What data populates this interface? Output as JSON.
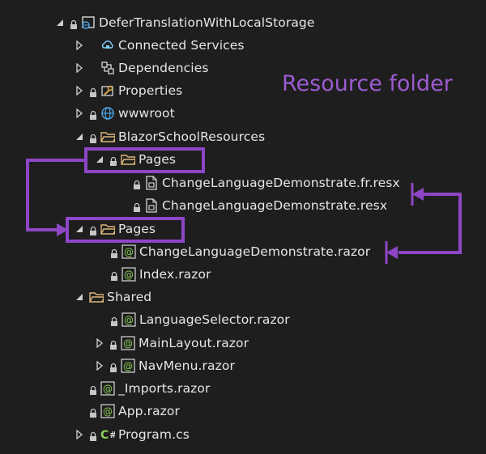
{
  "annotation": "Resource folder",
  "accent_color": "#8e46c7",
  "tree": [
    {
      "label": "DeferTranslationWithLocalStorage",
      "icon": "project-icon",
      "arrow": "expanded",
      "lock": true
    },
    {
      "label": "Connected Services",
      "icon": "cloud-service-icon",
      "arrow": "collapsed",
      "lock": false
    },
    {
      "label": "Dependencies",
      "icon": "dependencies-icon",
      "arrow": "collapsed",
      "lock": false
    },
    {
      "label": "Properties",
      "icon": "wrench-icon",
      "arrow": "collapsed",
      "lock": true
    },
    {
      "label": "wwwroot",
      "icon": "globe-icon",
      "arrow": "collapsed",
      "lock": true
    },
    {
      "label": "BlazorSchoolResources",
      "icon": "folder-icon",
      "arrow": "expanded",
      "lock": true
    },
    {
      "label": "Pages",
      "icon": "folder-icon",
      "arrow": "expanded",
      "lock": true
    },
    {
      "label": "ChangeLanguageDemonstrate.fr.resx",
      "icon": "resx-icon",
      "arrow": "none",
      "lock": true
    },
    {
      "label": "ChangeLanguageDemonstrate.resx",
      "icon": "resx-icon",
      "arrow": "none",
      "lock": true
    },
    {
      "label": "Pages",
      "icon": "folder-icon",
      "arrow": "expanded",
      "lock": true
    },
    {
      "label": "ChangeLanguageDemonstrate.razor",
      "icon": "razor-icon",
      "arrow": "none",
      "lock": true
    },
    {
      "label": "Index.razor",
      "icon": "razor-icon",
      "arrow": "none",
      "lock": true
    },
    {
      "label": "Shared",
      "icon": "folder-icon",
      "arrow": "expanded",
      "lock": false
    },
    {
      "label": "LanguageSelector.razor",
      "icon": "razor-icon",
      "arrow": "none",
      "lock": true
    },
    {
      "label": "MainLayout.razor",
      "icon": "razor-icon",
      "arrow": "collapsed",
      "lock": true
    },
    {
      "label": "NavMenu.razor",
      "icon": "razor-icon",
      "arrow": "collapsed",
      "lock": true
    },
    {
      "label": "_Imports.razor",
      "icon": "razor-icon",
      "arrow": "none",
      "lock": true
    },
    {
      "label": "App.razor",
      "icon": "razor-icon",
      "arrow": "none",
      "lock": true
    },
    {
      "label": "Program.cs",
      "icon": "csharp-icon",
      "arrow": "collapsed",
      "lock": true
    }
  ]
}
